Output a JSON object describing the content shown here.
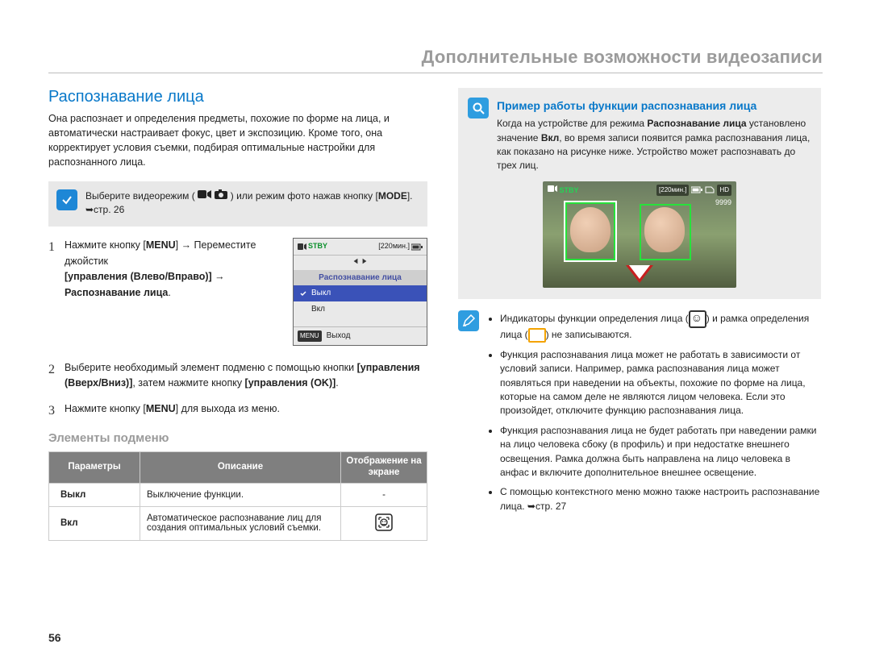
{
  "pageTitle": "Дополнительные возможности видеозаписи",
  "pageNumber": "56",
  "heading": "Распознавание лица",
  "introText": "Она распознает и определения предметы, похожие по форме на лица, и автоматически настраивает фокус, цвет и экспозицию. Кроме того, она корректирует условия съемки, подбирая оптимальные настройки для распознанного лица.",
  "calloutGrey": {
    "pre": "Выберите видеорежим ( ",
    "mid": " ) или режим фото нажав кнопку [",
    "mode": "MODE",
    "post": "]. ➥стр. 26"
  },
  "steps": [
    {
      "no": "1",
      "parts": [
        "Нажмите кнопку [",
        "MENU",
        "] → Переместите джойстик ",
        "[управления (Влево/Вправо)]",
        " → ",
        "Распознавание лица",
        "."
      ]
    },
    {
      "no": "2",
      "parts": [
        "Выберите необходимый элемент подменю с помощью кнопки ",
        "[управления (Вверх/Вниз)]",
        ", затем нажмите кнопку ",
        "[управления (OK)]",
        "."
      ]
    },
    {
      "no": "3",
      "parts": [
        "Нажмите кнопку [",
        "MENU",
        "] для выхода из меню."
      ]
    }
  ],
  "menuThumb": {
    "stby": "STBY",
    "time": "[220мин.]",
    "title": "Распознавание лица",
    "optOff": "Выкл",
    "optOn": "Вкл",
    "menuKey": "MENU",
    "exit": "Выход"
  },
  "subSectionHeading": "Элементы подменю",
  "tableHeaders": {
    "param": "Параметры",
    "desc": "Описание",
    "display": "Отображение на экране"
  },
  "tableRows": [
    {
      "label": "Выкл",
      "desc": "Выключение функции.",
      "display": "-"
    },
    {
      "label": "Вкл",
      "desc": "Автоматическое распознавание лиц для создания оптимальных условий съемки.",
      "display": "icon"
    }
  ],
  "rightBox": {
    "title": "Пример работы функции распознавания лица",
    "text1a": "Когда на устройстве для режима ",
    "text1b": "Распознавание лица",
    "text1c": " установлено значение ",
    "text1d": "Вкл",
    "text1e": ", во время записи появится рамка распознавания лица, как показано на рисунке ниже. Устройство может распознавать до трех лиц.",
    "preview": {
      "stby": "STBY",
      "time": "[220мин.]",
      "hd": "HD",
      "count": "9999"
    }
  },
  "notes": [
    "Индикаторы функции определения лица ( ⬚ ) и рамка определения лица ( ⬚ ) не записываются.",
    "Функция распознавания лица может не работать в зависимости от условий записи. Например, рамка распознавания лица может появляться при наведении на объекты, похожие по форме на лица, которые на самом деле не являются лицом человека. Если это произойдет, отключите функцию распознавания лица.",
    "Функция распознавания лица не будет работать при наведении рамки на лицо человека сбоку (в профиль) и при недостатке внешнего освещения. Рамка должна быть направлена на лицо человека в анфас и включите дополнительное внешнее освещение.",
    "С помощью контекстного меню можно также настроить распознавание лица. ➥стр. 27"
  ]
}
